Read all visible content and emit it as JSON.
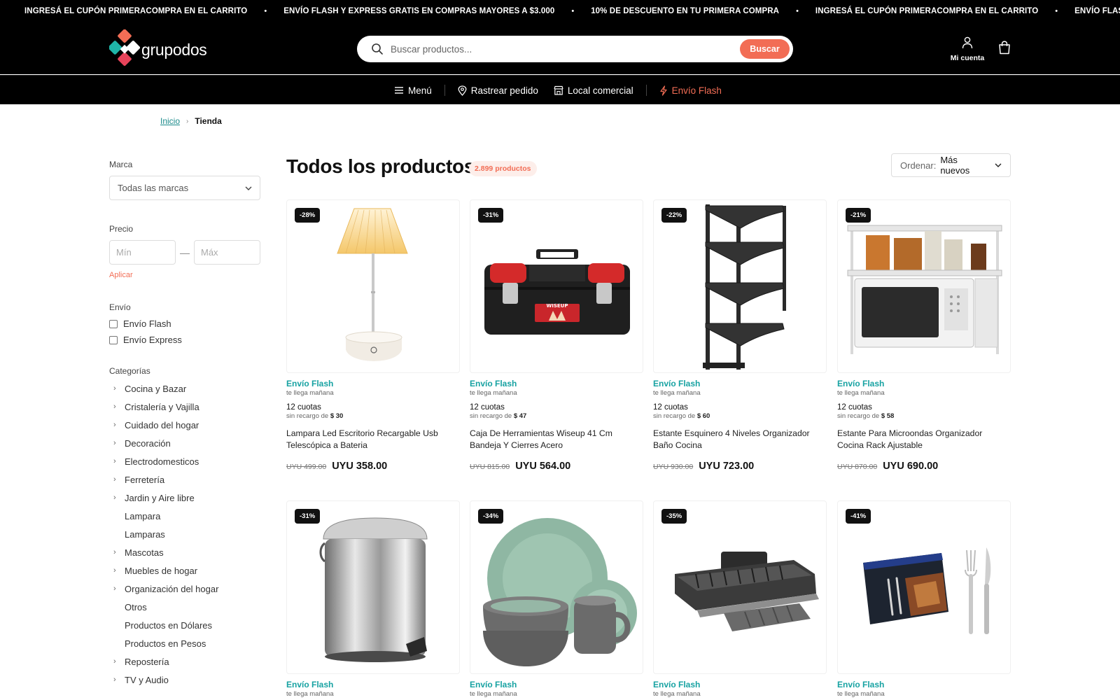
{
  "promo": {
    "messages": [
      "INGRESÁ EL CUPÓN PRIMERACOMPRA EN EL CARRITO",
      "ENVÍO FLASH Y EXPRESS GRATIS EN COMPRAS MAYORES A $3.000",
      "10% DE DESCUENTO EN TU PRIMERA COMPRA",
      "INGRESÁ EL CUPÓN PRIMERACOMPRA EN EL CARRITO",
      "ENVÍO FLASH Y EXPRESS GRATIS E"
    ],
    "separator": "•"
  },
  "header": {
    "logo_text": "grupodos",
    "search_placeholder": "Buscar productos...",
    "search_button": "Buscar",
    "account_label": "Mi cuenta"
  },
  "nav": {
    "menu": "Menú",
    "track": "Rastrear pedido",
    "store": "Local comercial",
    "flash": "Envío Flash"
  },
  "breadcrumb": {
    "home": "Inicio",
    "separator": "›",
    "current": "Tienda"
  },
  "sidebar": {
    "brand_heading": "Marca",
    "brand_value": "Todas las marcas",
    "price_heading": "Precio",
    "price_min_placeholder": "Mín",
    "price_max_placeholder": "Máx",
    "price_dash": "—",
    "apply": "Aplicar",
    "shipping_heading": "Envío",
    "shipping_options": [
      "Envío Flash",
      "Envío Express"
    ],
    "categories_heading": "Categorías",
    "categories": [
      {
        "label": "Cocina y Bazar",
        "expandable": true
      },
      {
        "label": "Cristalería y Vajilla",
        "expandable": true
      },
      {
        "label": "Cuidado del hogar",
        "expandable": true
      },
      {
        "label": "Decoración",
        "expandable": true
      },
      {
        "label": "Electrodomesticos",
        "expandable": true
      },
      {
        "label": "Ferretería",
        "expandable": true
      },
      {
        "label": "Jardin y Aire libre",
        "expandable": true
      },
      {
        "label": "Lampara",
        "expandable": false
      },
      {
        "label": "Lamparas",
        "expandable": false
      },
      {
        "label": "Mascotas",
        "expandable": true
      },
      {
        "label": "Muebles de hogar",
        "expandable": true
      },
      {
        "label": "Organización del hogar",
        "expandable": true
      },
      {
        "label": "Otros",
        "expandable": false
      },
      {
        "label": "Productos en Dólares",
        "expandable": false
      },
      {
        "label": "Productos en Pesos",
        "expandable": false
      },
      {
        "label": "Repostería",
        "expandable": true
      },
      {
        "label": "TV y Audio",
        "expandable": true
      }
    ]
  },
  "main": {
    "title": "Todos los productos",
    "count": "2.899 productos",
    "sort_label": "Ordenar:",
    "sort_value": "Más nuevos"
  },
  "products": [
    {
      "discount": "-28%",
      "shipping": "Envío Flash",
      "shipping_sub": "te llega mañana",
      "installments": "12 cuotas",
      "installments_sub": "sin recargo de",
      "installment_amount": "$ 30",
      "name": "Lampara Led Escritorio Recargable Usb Telescópica a Bateria",
      "old_price": "UYU 499.00",
      "price": "UYU 358.00",
      "image": "lamp"
    },
    {
      "discount": "-31%",
      "shipping": "Envío Flash",
      "shipping_sub": "te llega mañana",
      "installments": "12 cuotas",
      "installments_sub": "sin recargo de",
      "installment_amount": "$ 47",
      "name": "Caja De Herramientas Wiseup 41 Cm Bandeja Y Cierres Acero",
      "old_price": "UYU 815.00",
      "price": "UYU 564.00",
      "image": "toolbox",
      "image_text": "WISEUP"
    },
    {
      "discount": "-22%",
      "shipping": "Envío Flash",
      "shipping_sub": "te llega mañana",
      "installments": "12 cuotas",
      "installments_sub": "sin recargo de",
      "installment_amount": "$ 60",
      "name": "Estante Esquinero 4 Niveles Organizador Baño Cocina",
      "old_price": "UYU 930.00",
      "price": "UYU 723.00",
      "image": "corner-shelf"
    },
    {
      "discount": "-21%",
      "shipping": "Envío Flash",
      "shipping_sub": "te llega mañana",
      "installments": "12 cuotas",
      "installments_sub": "sin recargo de",
      "installment_amount": "$ 58",
      "name": "Estante Para Microondas Organizador Cocina Rack Ajustable",
      "old_price": "UYU 870.00",
      "price": "UYU 690.00",
      "image": "microwave-rack"
    },
    {
      "discount": "-31%",
      "shipping": "Envío Flash",
      "shipping_sub": "te llega mañana",
      "image": "trash-can"
    },
    {
      "discount": "-34%",
      "shipping": "Envío Flash",
      "shipping_sub": "te llega mañana",
      "image": "dish-set"
    },
    {
      "discount": "-35%",
      "shipping": "Envío Flash",
      "shipping_sub": "te llega mañana",
      "image": "dish-rack"
    },
    {
      "discount": "-41%",
      "shipping": "Envío Flash",
      "shipping_sub": "te llega mañana",
      "image": "cutlery-set"
    }
  ],
  "colors": {
    "accent": "#f26d55",
    "teal": "#17a2a2",
    "header_bg": "#000000"
  }
}
